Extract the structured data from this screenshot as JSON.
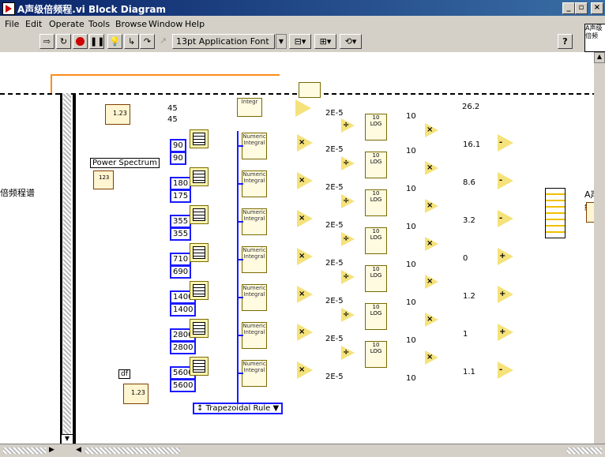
{
  "window": {
    "title": "A声级倍频程.vi Block Diagram",
    "buttons": [
      "_",
      "▫",
      "×"
    ]
  },
  "menu": [
    "File",
    "Edit",
    "Operate",
    "Tools",
    "Browse",
    "Window",
    "Help"
  ],
  "toolbar": {
    "font": "13pt Application Font",
    "help_label": "?"
  },
  "context_help_text": "A声级倍频",
  "diagram": {
    "labels": {
      "power_spectrum": "Power Spectrum",
      "octave_label": "倍频程谱",
      "df_label": "df",
      "right_label": "A声级",
      "dbl_const_1": "1.23",
      "dbl_const_2": "1.23",
      "dbl_const_3": "123",
      "top_consts": [
        "45",
        "45"
      ],
      "top_value": "26.2"
    },
    "rows": [
      {
        "lo": "90",
        "hi": "90",
        "mul": "2E-5",
        "ten": "10",
        "offset": "16.1",
        "op": "-"
      },
      {
        "lo": "180",
        "hi": "175",
        "mul": "2E-5",
        "ten": "10",
        "offset": "8.6",
        "op": "-"
      },
      {
        "lo": "355",
        "hi": "355",
        "mul": "2E-5",
        "ten": "10",
        "offset": "3.2",
        "op": "-"
      },
      {
        "lo": "710",
        "hi": "690",
        "mul": "2E-5",
        "ten": "10",
        "offset": "0",
        "op": "+"
      },
      {
        "lo": "1400",
        "hi": "1400",
        "mul": "2E-5",
        "ten": "10",
        "offset": "1.2",
        "op": "+"
      },
      {
        "lo": "2800",
        "hi": "2800",
        "mul": "2E-5",
        "ten": "10",
        "offset": "1",
        "op": "+"
      },
      {
        "lo": "5600",
        "hi": "5600",
        "mul": "2E-5",
        "ten": "10",
        "offset": "1.1",
        "op": "-"
      }
    ],
    "top_row": {
      "mul": "2E-5",
      "ten": "10"
    },
    "integrate_label": "Numeric Integral",
    "integrate_top": "Integr",
    "log_label": "LOG",
    "log_ten": "10",
    "rule": "Trapezoidal Rule"
  }
}
